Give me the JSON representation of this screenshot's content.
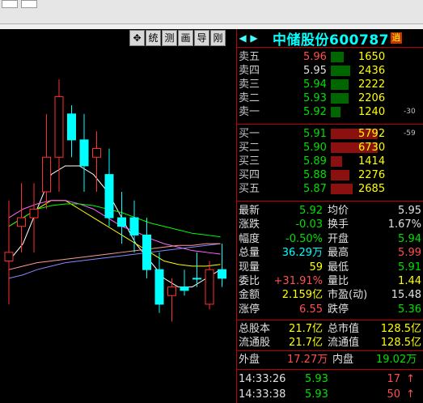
{
  "toolbar": [
    "✥",
    "统",
    "测",
    "画",
    "导",
    "刚"
  ],
  "stock": {
    "name": "中储股份",
    "code": "600787",
    "badge": "逍",
    "nav_left": "◀",
    "nav_right": "▶"
  },
  "asks": [
    {
      "label": "卖五",
      "price": "5.96",
      "volume": "1650",
      "diff": "",
      "level": 0.28
    },
    {
      "label": "卖四",
      "price": "5.95",
      "volume": "2436",
      "diff": "",
      "level": 0.42
    },
    {
      "label": "卖三",
      "price": "5.94",
      "volume": "2222",
      "diff": "",
      "level": 0.38
    },
    {
      "label": "卖二",
      "price": "5.93",
      "volume": "2206",
      "diff": "",
      "level": 0.38
    },
    {
      "label": "卖一",
      "price": "5.92",
      "volume": "1240",
      "diff": "-30",
      "level": 0.21
    }
  ],
  "bids": [
    {
      "label": "买一",
      "price": "5.91",
      "volume": "5792",
      "diff": "-59",
      "level": 1.0
    },
    {
      "label": "买二",
      "price": "5.90",
      "volume": "6730",
      "diff": "",
      "level": 1.0
    },
    {
      "label": "买三",
      "price": "5.89",
      "volume": "1414",
      "diff": "",
      "level": 0.24
    },
    {
      "label": "买四",
      "price": "5.88",
      "volume": "2276",
      "diff": "",
      "level": 0.39
    },
    {
      "label": "买五",
      "price": "5.87",
      "volume": "2685",
      "diff": "",
      "level": 0.46
    }
  ],
  "stats": [
    {
      "l1": "最新",
      "v1": "5.92",
      "c1": "green",
      "l2": "均价",
      "v2": "5.95",
      "c2": "white"
    },
    {
      "l1": "涨跌",
      "v1": "-0.03",
      "c1": "green",
      "l2": "换手",
      "v2": "1.67%",
      "c2": "white"
    },
    {
      "l1": "幅度",
      "v1": "-0.50%",
      "c1": "green",
      "l2": "开盘",
      "v2": "5.94",
      "c2": "green"
    },
    {
      "l1": "总量",
      "v1": "36.29万",
      "c1": "cyan",
      "l2": "最高",
      "v2": "5.99",
      "c2": "red"
    },
    {
      "l1": "现量",
      "v1": "59",
      "c1": "yellow",
      "l2": "最低",
      "v2": "5.91",
      "c2": "green"
    },
    {
      "l1": "委比",
      "v1": "+31.91%",
      "c1": "red",
      "l2": "量比",
      "v2": "1.44",
      "c2": "yellow"
    },
    {
      "l1": "金额",
      "v1": "2.159亿",
      "c1": "yellow",
      "l2": "市盈(动)",
      "v2": "15.48",
      "c2": "white"
    },
    {
      "l1": "涨停",
      "v1": "6.55",
      "c1": "red",
      "l2": "跌停",
      "v2": "5.36",
      "c2": "green"
    }
  ],
  "capital": [
    {
      "l1": "总股本",
      "v1": "21.7亿",
      "l2": "总市值",
      "v2": "128.5亿"
    },
    {
      "l1": "流通股",
      "v1": "21.7亿",
      "l2": "流通值",
      "v2": "128.5亿"
    }
  ],
  "flow": {
    "out_label": "外盘",
    "out_value": "17.27万",
    "in_label": "内盘",
    "in_value": "19.02万"
  },
  "ticks": [
    {
      "time": "14:33:26",
      "price": "5.93",
      "volume": "17",
      "arrow": "↑"
    },
    {
      "time": "14:33:38",
      "price": "5.93",
      "volume": "50",
      "arrow": "↑"
    }
  ],
  "chart_data": {
    "type": "candlestick",
    "series": [
      {
        "o": 5.905,
        "h": 5.935,
        "l": 5.875,
        "c": 5.9,
        "up": true
      },
      {
        "o": 5.92,
        "h": 5.945,
        "l": 5.905,
        "c": 5.925,
        "up": true
      },
      {
        "o": 5.925,
        "h": 5.945,
        "l": 5.905,
        "c": 5.93,
        "up": true
      },
      {
        "o": 5.94,
        "h": 5.985,
        "l": 5.93,
        "c": 5.96,
        "up": true
      },
      {
        "o": 5.96,
        "h": 6.005,
        "l": 5.94,
        "c": 5.995,
        "up": true
      },
      {
        "o": 5.985,
        "h": 5.99,
        "l": 5.96,
        "c": 5.97,
        "up": false
      },
      {
        "o": 5.97,
        "h": 5.985,
        "l": 5.94,
        "c": 5.955,
        "up": false
      },
      {
        "o": 5.96,
        "h": 5.975,
        "l": 5.94,
        "c": 5.965,
        "up": true
      },
      {
        "o": 5.95,
        "h": 5.965,
        "l": 5.92,
        "c": 5.925,
        "up": false
      },
      {
        "o": 5.925,
        "h": 5.94,
        "l": 5.91,
        "c": 5.92,
        "up": false
      },
      {
        "o": 5.925,
        "h": 5.935,
        "l": 5.905,
        "c": 5.915,
        "up": false
      },
      {
        "o": 5.915,
        "h": 5.925,
        "l": 5.89,
        "c": 5.895,
        "up": false
      },
      {
        "o": 5.895,
        "h": 5.905,
        "l": 5.87,
        "c": 5.875,
        "up": false
      },
      {
        "o": 5.88,
        "h": 5.89,
        "l": 5.865,
        "c": 5.885,
        "up": true
      },
      {
        "o": 5.885,
        "h": 5.895,
        "l": 5.88,
        "c": 5.883,
        "up": false
      },
      {
        "o": 5.89,
        "h": 5.905,
        "l": 5.885,
        "c": 5.89,
        "up": false
      },
      {
        "o": 5.875,
        "h": 5.9,
        "l": 5.872,
        "c": 5.895,
        "up": true
      },
      {
        "o": 5.895,
        "h": 5.91,
        "l": 5.885,
        "c": 5.89,
        "up": false
      }
    ],
    "ylim": [
      5.86,
      6.02
    ],
    "moving_averages": [
      {
        "color": "#ffffff",
        "values": [
          5.9,
          5.91,
          5.93,
          5.95,
          5.955,
          5.955,
          5.95,
          5.94,
          5.925,
          5.91,
          5.9,
          5.89,
          5.885,
          5.885,
          5.89,
          5.895
        ]
      },
      {
        "color": "#ffff00",
        "values": [
          5.92,
          5.925,
          5.93,
          5.935,
          5.935,
          5.93,
          5.925,
          5.92,
          5.915,
          5.91,
          5.905,
          5.9,
          5.898,
          5.897,
          5.897,
          5.898
        ]
      },
      {
        "color": "#ff66ff",
        "values": [
          5.925,
          5.93,
          5.933,
          5.935,
          5.935,
          5.933,
          5.93,
          5.925,
          5.92,
          5.917,
          5.913,
          5.91,
          5.908,
          5.906,
          5.905,
          5.904
        ]
      },
      {
        "color": "#00ff00",
        "values": [
          5.92,
          5.925,
          5.93,
          5.932,
          5.933,
          5.933,
          5.932,
          5.93,
          5.928,
          5.925,
          5.922,
          5.92,
          5.918,
          5.916,
          5.915,
          5.914
        ]
      },
      {
        "color": "#8888ff",
        "values": [
          5.89,
          5.892,
          5.895,
          5.897,
          5.899,
          5.9,
          5.901,
          5.902,
          5.903,
          5.904,
          5.905,
          5.906,
          5.907,
          5.908,
          5.909,
          5.91
        ]
      },
      {
        "color": "#ff9999",
        "values": [
          5.895,
          5.897,
          5.899,
          5.9,
          5.901,
          5.902,
          5.903,
          5.904,
          5.905,
          5.906,
          5.907,
          5.908,
          5.909,
          5.909,
          5.91,
          5.91
        ]
      }
    ],
    "colors": {
      "up": "#ff3030",
      "down": "#00ffff"
    }
  }
}
